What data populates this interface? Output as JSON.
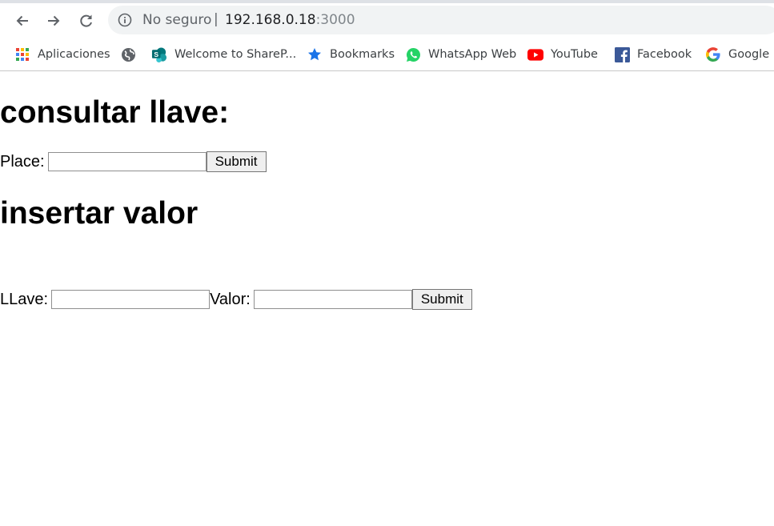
{
  "browser": {
    "security_label": "No seguro",
    "separator": "|",
    "url_host": "192.168.0.18",
    "url_port": ":3000"
  },
  "bookmarks": [
    {
      "label": "Aplicaciones",
      "icon": "apps-grid-icon"
    },
    {
      "label": "",
      "icon": "globe-icon"
    },
    {
      "label": "Welcome to ShareP...",
      "icon": "sharepoint-icon"
    },
    {
      "label": "Bookmarks",
      "icon": "star-icon"
    },
    {
      "label": "WhatsApp Web",
      "icon": "whatsapp-icon"
    },
    {
      "label": "YouTube",
      "icon": "youtube-icon"
    },
    {
      "label": "Facebook",
      "icon": "facebook-icon"
    },
    {
      "label": "Google",
      "icon": "google-icon"
    }
  ],
  "consult": {
    "heading": "consultar llave:",
    "label": "Place:",
    "value": "",
    "submit_label": "Submit"
  },
  "insert": {
    "heading": "insertar valor",
    "key_label": "LLave:",
    "key_value": "",
    "value_label": "Valor:",
    "value_value": "",
    "submit_label": "Submit"
  }
}
